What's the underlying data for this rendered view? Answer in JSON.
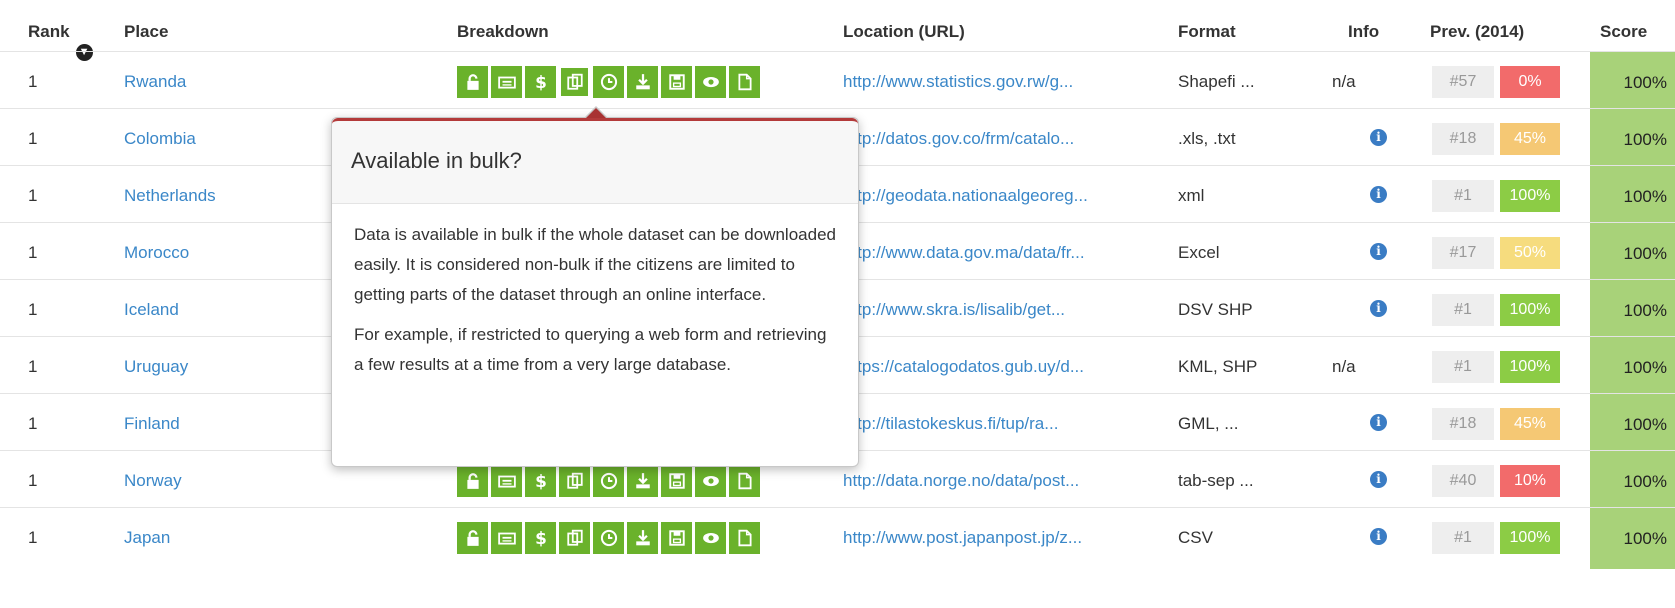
{
  "header": {
    "rank": "Rank",
    "place": "Place",
    "breakdown": "Breakdown",
    "location": "Location (URL)",
    "format": "Format",
    "info": "Info",
    "prev": "Prev. (2014)",
    "score": "Score",
    "sort_icon": "arrow-down-circle-icon"
  },
  "breakdown_icons": [
    "lock-icon",
    "keyboard-icon",
    "dollar-icon",
    "copy-icon",
    "clock-icon",
    "download-icon",
    "save-icon",
    "eye-icon",
    "file-icon"
  ],
  "colors": {
    "green": "#6ab22b",
    "link": "#3a87c8",
    "score_bg": "#a8d279",
    "red": "#f26b6b",
    "orange": "#f5c874",
    "light_green": "#8ccc45"
  },
  "rows": [
    {
      "rank": "1",
      "place": "Rwanda",
      "url": "http://www.statistics.gov.rw/g...",
      "format": "Shapefi ...",
      "info": "n/a",
      "prev_rank": "#57",
      "prev_pct": "0%",
      "prev_color": "#f26b6b",
      "score": "100%"
    },
    {
      "rank": "1",
      "place": "Colombia",
      "url": "http://datos.gov.co/frm/catalo...",
      "format": ".xls, .txt",
      "info": "",
      "prev_rank": "#18",
      "prev_pct": "45%",
      "prev_color": "#f5c874",
      "score": "100%"
    },
    {
      "rank": "1",
      "place": "Netherlands",
      "url": "http://geodata.nationaalgeoreg...",
      "format": "xml",
      "info": "",
      "prev_rank": "#1",
      "prev_pct": "100%",
      "prev_color": "#8ccc45",
      "score": "100%"
    },
    {
      "rank": "1",
      "place": "Morocco",
      "url": "http://www.data.gov.ma/data/fr...",
      "format": "Excel",
      "info": "",
      "prev_rank": "#17",
      "prev_pct": "50%",
      "prev_color": "#f6dc7e",
      "score": "100%"
    },
    {
      "rank": "1",
      "place": "Iceland",
      "url": "http://www.skra.is/lisalib/get...",
      "format": "DSV SHP",
      "info": "",
      "prev_rank": "#1",
      "prev_pct": "100%",
      "prev_color": "#8ccc45",
      "score": "100%"
    },
    {
      "rank": "1",
      "place": "Uruguay",
      "url": "https://catalogodatos.gub.uy/d...",
      "format": "KML, SHP",
      "info": "n/a",
      "prev_rank": "#1",
      "prev_pct": "100%",
      "prev_color": "#8ccc45",
      "score": "100%"
    },
    {
      "rank": "1",
      "place": "Finland",
      "url": "http://tilastokeskus.fi/tup/ra...",
      "format": "GML, ...",
      "info": "",
      "prev_rank": "#18",
      "prev_pct": "45%",
      "prev_color": "#f5c874",
      "score": "100%"
    },
    {
      "rank": "1",
      "place": "Norway",
      "url": "http://data.norge.no/data/post...",
      "format": "tab-sep ...",
      "info": "",
      "prev_rank": "#40",
      "prev_pct": "10%",
      "prev_color": "#f26b6b",
      "score": "100%"
    },
    {
      "rank": "1",
      "place": "Japan",
      "url": "http://www.post.japanpost.jp/z...",
      "format": "CSV",
      "info": "",
      "prev_rank": "#1",
      "prev_pct": "100%",
      "prev_color": "#8ccc45",
      "score": "100%"
    }
  ],
  "tooltip": {
    "title": "Available in bulk?",
    "para1": "Data is available in bulk if the whole dataset can be downloaded easily. It is considered non-bulk if the citizens are limited to getting parts of the dataset through an online interface.",
    "para2": "For example, if restricted to querying a web form and retrieving a few results at a time from a very large database."
  }
}
